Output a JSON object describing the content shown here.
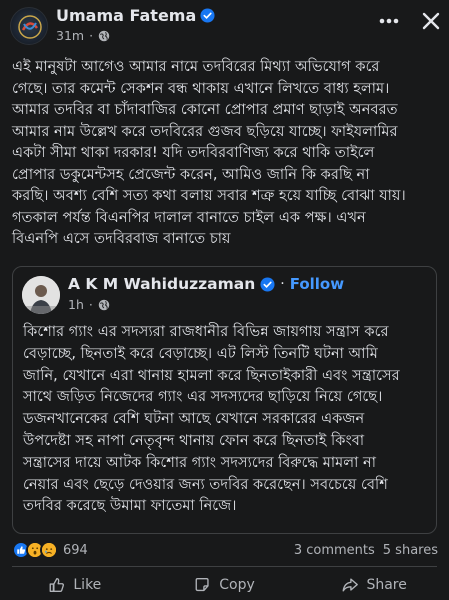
{
  "post": {
    "author": "Umama Fatema",
    "time": "31m",
    "text": "এই মানুষটা আগেও আমার নামে তদবিরের মিথ্যা অভিযোগ করে\nগেছে। তার কমেন্ট সেকশন বন্ধ থাকায় এখানে লিখতে বাধ্য হলাম।\nআমার তদবির বা চাঁদাবাজির কোনো প্রোপার প্রমাণ ছাড়াই অনবরত\nআমার নাম উল্লেখ করে তদবিরের গুজব ছড়িয়ে যাচ্ছে। ফাইযলামির\nএকটা সীমা থাকা দরকার! যদি তদবিরবাণিজ্য করে থাকি তাইলে\nপ্রোপার ডকুমেন্টসহ প্রেজেন্ট করেন, আমিও জানি কি করছি না\nকরছি। অবশ্য বেশি সত্য কথা বলায় সবার শত্রু হয়ে যাচ্ছি বোঝা যায়।\nগতকাল পর্যন্ত বিএনপির দালাল বানাতে চাইল এক পক্ষ। এখন\nবিএনপি এসে তদবিরবাজ বানাতে চায়"
  },
  "shared_post": {
    "author": "A K M Wahiduzzaman",
    "follow_label": "Follow",
    "time": "1h",
    "text": "কিশোর গ্যাং এর সদস্যরা রাজধানীর বিভিন্ন জায়গায় সন্ত্রাস করে\nবেড়াচ্ছে, ছিনতাই করে বেড়াচ্ছে। এট লিস্ট তিনটি ঘটনা আমি\nজানি, যেখানে এরা থানায় হামলা করে ছিনতাইকারী এবং সন্ত্রাসের\nসাথে জড়িত নিজেদের গ্যাং এর সদস্যদের ছাড়িয়ে নিয়ে গেছে।\nডজনখানেকের বেশি ঘটনা আছে যেখানে সরকারের একজন\nউপদেষ্টা সহ নাপা নেতৃবৃন্দ থানায় ফোন করে ছিনতাই কিংবা\nসন্ত্রাসের দায়ে আটক কিশোর গ্যাং সদস্যদের বিরুদ্ধে মামলা না\nনেয়ার এবং ছেড়ে দেওয়ার জন্য তদবির করেছেন। সবচেয়ে বেশি\nতদবির করেছে উমামা ফাতেমা নিজে।"
  },
  "reactions": {
    "icons": [
      "like-icon",
      "wow-icon",
      "sad-icon"
    ],
    "count": "694",
    "comments": "3 comments",
    "shares": "5 shares"
  },
  "actions": {
    "like": "Like",
    "copy": "Copy",
    "share": "Share"
  },
  "colors": {
    "background": "#18191a",
    "text": "#e4e6eb",
    "secondary": "#b0b3b8",
    "accent": "#4599ff",
    "verified": "#1877f2"
  }
}
